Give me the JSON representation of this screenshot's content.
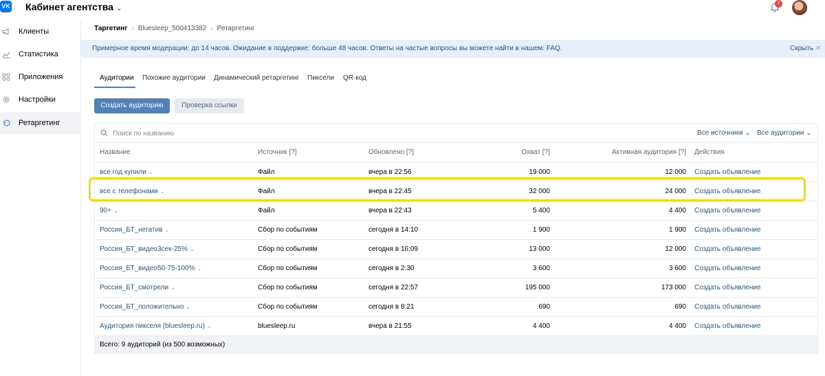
{
  "header": {
    "logo": "VK",
    "title": "Кабинет агентства",
    "notifications_count": "7"
  },
  "sidebar": {
    "items": [
      {
        "label": "Клиенты",
        "icon": "megaphone-icon"
      },
      {
        "label": "Статистика",
        "icon": "chart-icon"
      },
      {
        "label": "Приложения",
        "icon": "apps-icon"
      },
      {
        "label": "Настройки",
        "icon": "gear-icon"
      },
      {
        "label": "Ретаргетинг",
        "icon": "retarget-icon",
        "active": true
      }
    ]
  },
  "breadcrumbs": [
    "Таргетинг",
    "Bluesleep_500413382",
    "Ретаргетинг"
  ],
  "notice": {
    "text": "Примерное время модерации: до 14 часов. Ожидание в поддержке: больше 48 часов. Ответы на частые вопросы вы можете найти в нашем: FAQ.",
    "hide_label": "Скрыть"
  },
  "tabs": [
    "Аудитории",
    "Похожие аудитории",
    "Динамический ретаргетинг",
    "Пиксели",
    "QR-код"
  ],
  "buttons": {
    "create": "Создать аудиторию",
    "check_link": "Проверка ссылки"
  },
  "search": {
    "placeholder": "Поиск по названию",
    "filter_sources": "Все источники",
    "filter_audiences": "Все аудитории"
  },
  "table": {
    "columns": [
      "Название",
      "Источник [?]",
      "Обновлено [?]",
      "Охват [?]",
      "Активная аудитория [?]",
      "Действия"
    ],
    "rows": [
      {
        "name": "все год купили",
        "source": "Файл",
        "updated": "вчера в 22:56",
        "reach": "19 000",
        "active": "12 000",
        "action": "Создать объявление"
      },
      {
        "name": "все с телефонами",
        "source": "Файл",
        "updated": "вчера в 22:45",
        "reach": "32 000",
        "active": "24 000",
        "action": "Создать объявление"
      },
      {
        "name": "90+",
        "source": "Файл",
        "updated": "вчера в 22:43",
        "reach": "5 400",
        "active": "4 400",
        "action": "Создать объявление"
      },
      {
        "name": "Россия_БТ_негатив",
        "source": "Сбор по событиям",
        "updated": "сегодня в 14:10",
        "reach": "1 900",
        "active": "1 900",
        "action": "Создать объявление"
      },
      {
        "name": "Россия_БТ_видео3сек-25%",
        "source": "Сбор по событиям",
        "updated": "сегодня в 16:09",
        "reach": "13 000",
        "active": "12 000",
        "action": "Создать объявление"
      },
      {
        "name": "Россия_БТ_видео50-75-100%",
        "source": "Сбор по событиям",
        "updated": "сегодня в 2:30",
        "reach": "3 600",
        "active": "3 600",
        "action": "Создать объявление"
      },
      {
        "name": "Россия_БТ_смотрели",
        "source": "Сбор по событиям",
        "updated": "сегодня в 22:57",
        "reach": "195 000",
        "active": "173 000",
        "action": "Создать объявление"
      },
      {
        "name": "Россия_БТ_положительно",
        "source": "Сбор по событиям",
        "updated": "сегодня в 8:21",
        "reach": "690",
        "active": "690",
        "action": "Создать объявление"
      },
      {
        "name": "Аудитория пикселя (bluesleep.ru)",
        "source": "bluesleep.ru",
        "updated": "вчера в 21:55",
        "reach": "4 400",
        "active": "4 400",
        "action": "Создать объявление"
      }
    ],
    "footer": "Всего: 9 аудиторий (из 500 возможных)"
  },
  "colors": {
    "accent": "#5181b8",
    "link": "#2a5885",
    "notice_bg": "#e5f0fb",
    "highlight": "#f5d90a"
  }
}
